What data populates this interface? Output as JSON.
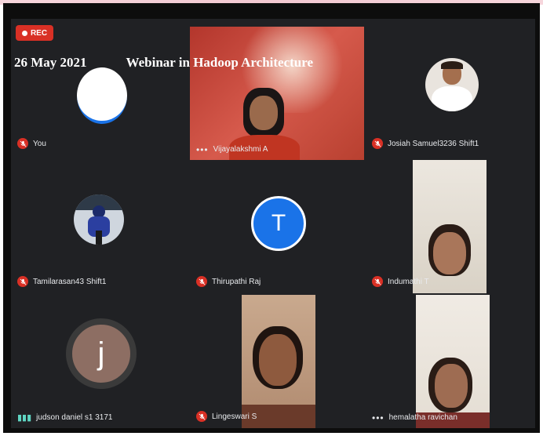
{
  "recording": {
    "label": "REC"
  },
  "banner": {
    "date": "26 May 2021",
    "title": "Webinar in  Hadoop Architecture"
  },
  "participants": [
    {
      "name": "You",
      "muted": true
    },
    {
      "name": "Vijayalakshmi A",
      "muted": false
    },
    {
      "name": "Josiah Samuel3236 Shift1",
      "muted": true
    },
    {
      "name": "Tamilarasan43 Shift1",
      "muted": true
    },
    {
      "name": "Thirupathi Raj",
      "muted": true,
      "initial": "T"
    },
    {
      "name": "Indumathi T",
      "muted": true
    },
    {
      "name": "judson daniel s1 3171",
      "muted": false,
      "initial": "j"
    },
    {
      "name": "Lingeswari S",
      "muted": true
    },
    {
      "name": "hemalatha ravichan",
      "muted": false
    }
  ],
  "colors": {
    "mute_red": "#d93025",
    "tile_bg": "#202124",
    "avatar_t": "#1a73e8",
    "avatar_j": "#8d6e63",
    "speaking": "#5fd6c3"
  }
}
